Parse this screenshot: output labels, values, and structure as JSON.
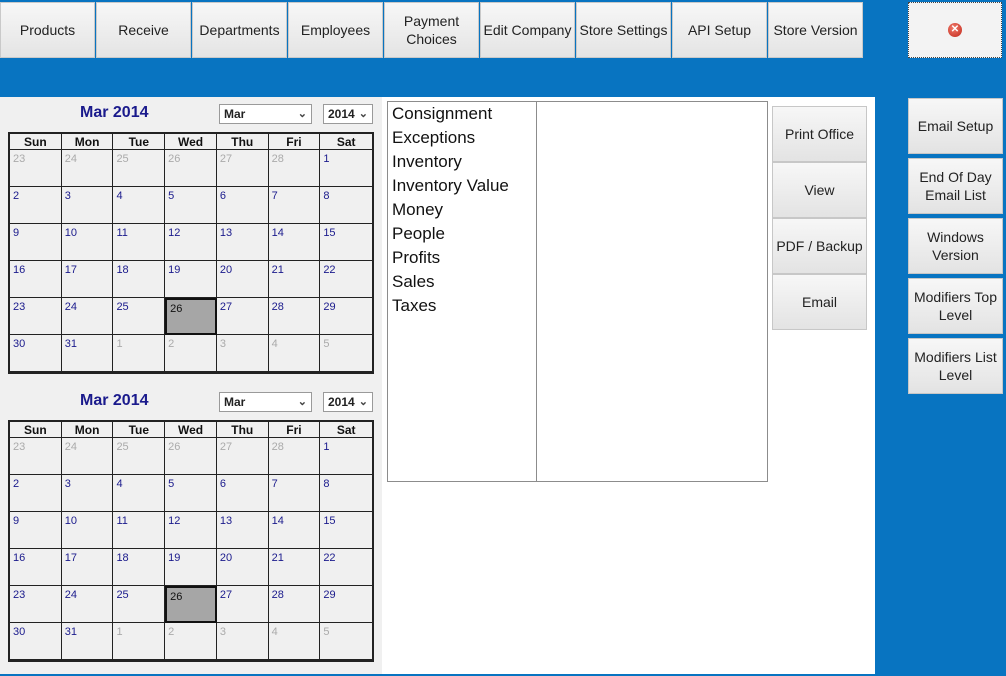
{
  "top_nav": [
    {
      "id": "products",
      "label": "Products"
    },
    {
      "id": "receive",
      "label": "Receive"
    },
    {
      "id": "departments",
      "label": "Departments"
    },
    {
      "id": "employees",
      "label": "Employees"
    },
    {
      "id": "payment",
      "label": "Payment\nChoices"
    },
    {
      "id": "edit-company",
      "label": "Edit Company"
    },
    {
      "id": "store-settings",
      "label": "Store Settings"
    },
    {
      "id": "api-setup",
      "label": "API Setup"
    },
    {
      "id": "store-version",
      "label": "Store Version"
    }
  ],
  "close_icon": "close-icon",
  "calendars": [
    {
      "title": "Mar 2014",
      "month_select": "Mar",
      "year_select": "2014",
      "weekdays": [
        "Sun",
        "Mon",
        "Tue",
        "Wed",
        "Thu",
        "Fri",
        "Sat"
      ],
      "weeks": [
        [
          {
            "d": "23",
            "o": true
          },
          {
            "d": "24",
            "o": true
          },
          {
            "d": "25",
            "o": true
          },
          {
            "d": "26",
            "o": true
          },
          {
            "d": "27",
            "o": true
          },
          {
            "d": "28",
            "o": true
          },
          {
            "d": "1"
          }
        ],
        [
          {
            "d": "2"
          },
          {
            "d": "3"
          },
          {
            "d": "4"
          },
          {
            "d": "5"
          },
          {
            "d": "6"
          },
          {
            "d": "7"
          },
          {
            "d": "8"
          }
        ],
        [
          {
            "d": "9"
          },
          {
            "d": "10"
          },
          {
            "d": "11"
          },
          {
            "d": "12"
          },
          {
            "d": "13"
          },
          {
            "d": "14"
          },
          {
            "d": "15"
          }
        ],
        [
          {
            "d": "16"
          },
          {
            "d": "17"
          },
          {
            "d": "18"
          },
          {
            "d": "19"
          },
          {
            "d": "20"
          },
          {
            "d": "21"
          },
          {
            "d": "22"
          }
        ],
        [
          {
            "d": "23"
          },
          {
            "d": "24"
          },
          {
            "d": "25"
          },
          {
            "d": "26",
            "s": true
          },
          {
            "d": "27"
          },
          {
            "d": "28"
          },
          {
            "d": "29"
          }
        ],
        [
          {
            "d": "30"
          },
          {
            "d": "31"
          },
          {
            "d": "1",
            "o": true
          },
          {
            "d": "2",
            "o": true
          },
          {
            "d": "3",
            "o": true
          },
          {
            "d": "4",
            "o": true
          },
          {
            "d": "5",
            "o": true
          }
        ]
      ]
    },
    {
      "title": "Mar 2014",
      "month_select": "Mar",
      "year_select": "2014",
      "weekdays": [
        "Sun",
        "Mon",
        "Tue",
        "Wed",
        "Thu",
        "Fri",
        "Sat"
      ],
      "weeks": [
        [
          {
            "d": "23",
            "o": true
          },
          {
            "d": "24",
            "o": true
          },
          {
            "d": "25",
            "o": true
          },
          {
            "d": "26",
            "o": true
          },
          {
            "d": "27",
            "o": true
          },
          {
            "d": "28",
            "o": true
          },
          {
            "d": "1"
          }
        ],
        [
          {
            "d": "2"
          },
          {
            "d": "3"
          },
          {
            "d": "4"
          },
          {
            "d": "5"
          },
          {
            "d": "6"
          },
          {
            "d": "7"
          },
          {
            "d": "8"
          }
        ],
        [
          {
            "d": "9"
          },
          {
            "d": "10"
          },
          {
            "d": "11"
          },
          {
            "d": "12"
          },
          {
            "d": "13"
          },
          {
            "d": "14"
          },
          {
            "d": "15"
          }
        ],
        [
          {
            "d": "16"
          },
          {
            "d": "17"
          },
          {
            "d": "18"
          },
          {
            "d": "19"
          },
          {
            "d": "20"
          },
          {
            "d": "21"
          },
          {
            "d": "22"
          }
        ],
        [
          {
            "d": "23"
          },
          {
            "d": "24"
          },
          {
            "d": "25"
          },
          {
            "d": "26",
            "s": true
          },
          {
            "d": "27"
          },
          {
            "d": "28"
          },
          {
            "d": "29"
          }
        ],
        [
          {
            "d": "30"
          },
          {
            "d": "31"
          },
          {
            "d": "1",
            "o": true
          },
          {
            "d": "2",
            "o": true
          },
          {
            "d": "3",
            "o": true
          },
          {
            "d": "4",
            "o": true
          },
          {
            "d": "5",
            "o": true
          }
        ]
      ]
    }
  ],
  "reports": [
    "Consignment",
    "Exceptions",
    "Inventory",
    "Inventory Value",
    "Money",
    "People",
    "Profits",
    "Sales",
    "Taxes"
  ],
  "actions": [
    {
      "id": "print-office",
      "label": "Print Office"
    },
    {
      "id": "view",
      "label": "View"
    },
    {
      "id": "pdf-backup",
      "label": "PDF / Backup"
    },
    {
      "id": "email",
      "label": "Email"
    }
  ],
  "right_buttons": [
    {
      "id": "email-setup",
      "label": "Email Setup"
    },
    {
      "id": "end-of-day",
      "label": "End Of Day\nEmail List"
    },
    {
      "id": "windows-version",
      "label": "Windows\nVersion"
    },
    {
      "id": "modifiers-top",
      "label": "Modifiers Top\nLevel"
    },
    {
      "id": "modifiers-list",
      "label": "Modifiers List\nLevel"
    }
  ]
}
